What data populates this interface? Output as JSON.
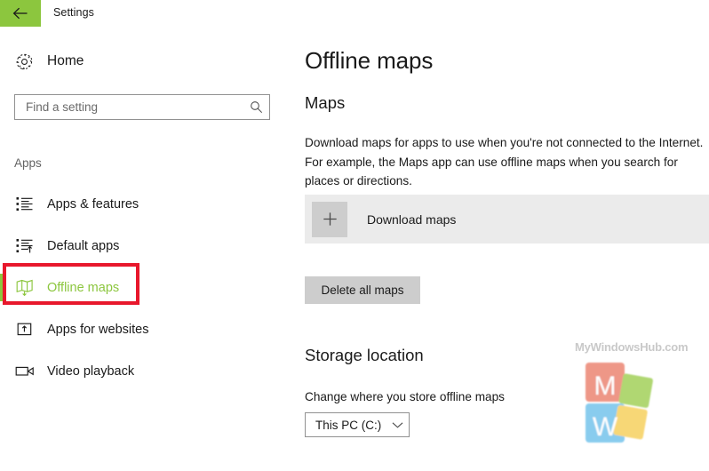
{
  "window": {
    "title": "Settings",
    "back_icon": "back-arrow-icon"
  },
  "sidebar": {
    "home": {
      "label": "Home",
      "icon": "gear-icon"
    },
    "search": {
      "placeholder": "Find a setting",
      "value": "",
      "icon": "search-icon"
    },
    "category_label": "Apps",
    "items": [
      {
        "label": "Apps & features",
        "icon": "apps-list-icon",
        "selected": false
      },
      {
        "label": "Default apps",
        "icon": "default-apps-icon",
        "selected": false
      },
      {
        "label": "Offline maps",
        "icon": "offline-maps-icon",
        "selected": true
      },
      {
        "label": "Apps for websites",
        "icon": "apps-for-websites-icon",
        "selected": false
      },
      {
        "label": "Video playback",
        "icon": "video-playback-icon",
        "selected": false
      }
    ],
    "accent_color": "#8CC63E",
    "annotation_color": "#E8172C"
  },
  "main": {
    "page_title": "Offline maps",
    "maps_section": {
      "title": "Maps",
      "description": "Download maps for apps to use when you're not connected to the Internet. For example, the Maps app can use offline maps when you search for places or directions.",
      "download_maps_label": "Download maps",
      "download_maps_icon": "plus-icon",
      "delete_all_maps_label": "Delete all maps"
    },
    "storage_section": {
      "title": "Storage location",
      "description": "Change where you store offline maps",
      "select_value": "This PC (C:)",
      "select_icon": "chevron-down-icon"
    }
  },
  "watermark": {
    "text": "MyWindowsHub.com",
    "logo_letters": [
      "M",
      "W"
    ],
    "logo_colors": {
      "m_tile": "#E8705A",
      "w_tile": "#5BB9E8",
      "green_tile": "#92C83E",
      "yellow_tile": "#F5C842"
    }
  }
}
